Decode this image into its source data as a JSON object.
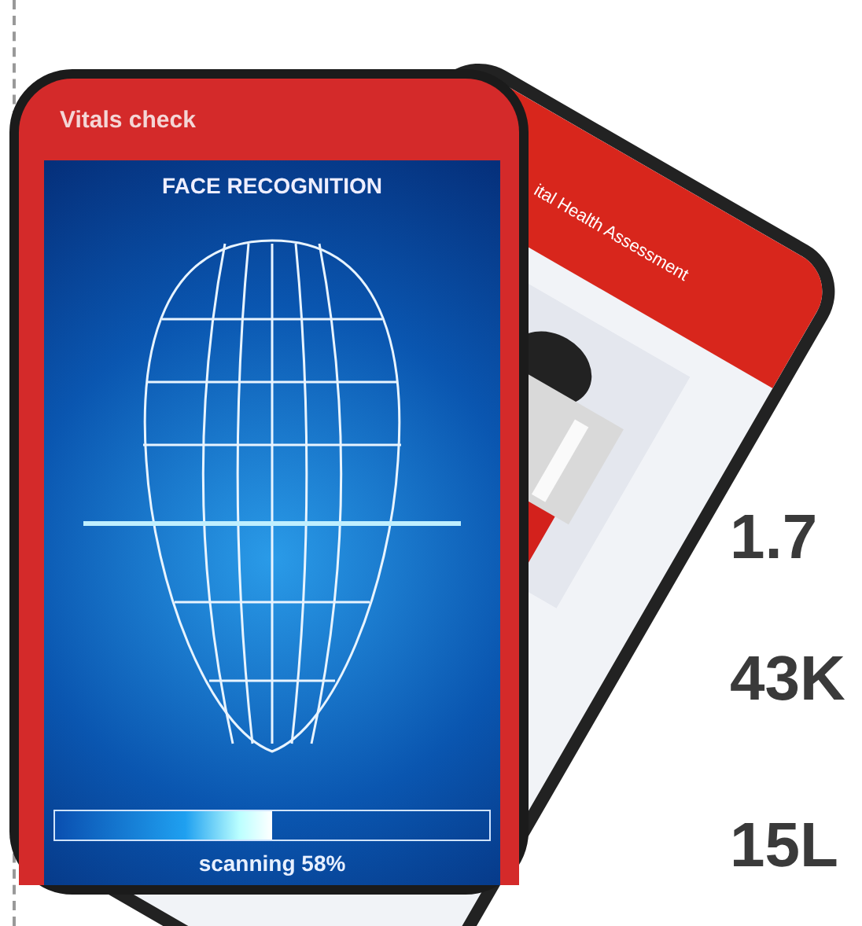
{
  "back_phone": {
    "title": "ital Health Assessment"
  },
  "front_phone": {
    "header": "Vitals check",
    "screen_title": "FACE RECOGNITION",
    "progress": {
      "level": 0.5,
      "reading": "scanning 58%"
    }
  },
  "stats": [
    {
      "value": "1.7"
    },
    {
      "value": "43K"
    },
    {
      "value": "15L"
    }
  ]
}
